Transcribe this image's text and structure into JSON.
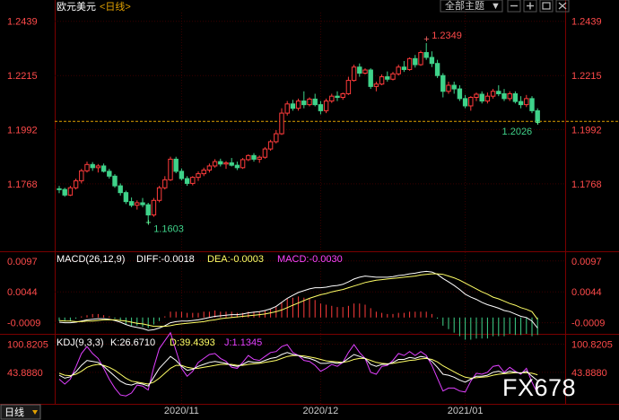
{
  "header": {
    "title": "欧元美元",
    "period": "<日线>",
    "mode_button": "全部主题",
    "mode_arrow": "▼"
  },
  "colors": {
    "up": "#ff3b3b",
    "down": "#3fd38a",
    "price_axis": "#ff4a4a",
    "last_price_line": "#e0a000",
    "diff": "#ffffff",
    "dea": "#ffff66",
    "macd_label": "#ff44ff",
    "k": "#ffffff",
    "d": "#ffff66",
    "j": "#e040ff",
    "grid": "#3a0000",
    "frame": "#7a0000"
  },
  "main": {
    "ylim": [
      1.149,
      1.2475
    ],
    "axis_ticks": [
      {
        "value": 1.2439,
        "label": "1.2439"
      },
      {
        "value": 1.2215,
        "label": "1.2215"
      },
      {
        "value": 1.1992,
        "label": "1.1992"
      },
      {
        "value": 1.1768,
        "label": "1.1768"
      }
    ],
    "high_label": "1.2349",
    "low_label": "1.1603",
    "last_label": "1.2026",
    "last_price": 1.2026
  },
  "chart_data": {
    "type": "candlestick",
    "series_name": "欧元美元",
    "period": "日线",
    "x_tick_labels": [
      {
        "index": 22,
        "label": "2020/11"
      },
      {
        "index": 47,
        "label": "2020/12"
      },
      {
        "index": 73,
        "label": "2021/01"
      }
    ],
    "ohlc": [
      [
        1.1748,
        1.176,
        1.173,
        1.1745
      ],
      [
        1.1745,
        1.1752,
        1.1715,
        1.1722
      ],
      [
        1.1722,
        1.176,
        1.1718,
        1.1752
      ],
      [
        1.1752,
        1.179,
        1.1745,
        1.1781
      ],
      [
        1.1781,
        1.183,
        1.177,
        1.1822
      ],
      [
        1.1822,
        1.186,
        1.1815,
        1.1848
      ],
      [
        1.1848,
        1.1858,
        1.1822,
        1.1835
      ],
      [
        1.1835,
        1.185,
        1.1815,
        1.1842
      ],
      [
        1.1842,
        1.1852,
        1.1815,
        1.182
      ],
      [
        1.182,
        1.183,
        1.179,
        1.18
      ],
      [
        1.18,
        1.1808,
        1.1752,
        1.176
      ],
      [
        1.176,
        1.177,
        1.172,
        1.1732
      ],
      [
        1.1732,
        1.174,
        1.1685,
        1.1695
      ],
      [
        1.1695,
        1.1712,
        1.1672,
        1.168
      ],
      [
        1.168,
        1.17,
        1.1662,
        1.169
      ],
      [
        1.169,
        1.171,
        1.1672,
        1.1682
      ],
      [
        1.1682,
        1.169,
        1.1603,
        1.164
      ],
      [
        1.164,
        1.171,
        1.1632,
        1.17
      ],
      [
        1.17,
        1.176,
        1.1692,
        1.1752
      ],
      [
        1.1752,
        1.18,
        1.1745,
        1.1785
      ],
      [
        1.1785,
        1.188,
        1.178,
        1.187
      ],
      [
        1.187,
        1.188,
        1.1812,
        1.182
      ],
      [
        1.182,
        1.1832,
        1.1782,
        1.179
      ],
      [
        1.179,
        1.18,
        1.176,
        1.177
      ],
      [
        1.177,
        1.18,
        1.1762,
        1.1795
      ],
      [
        1.1795,
        1.182,
        1.178,
        1.181
      ],
      [
        1.181,
        1.1835,
        1.18,
        1.1825
      ],
      [
        1.1825,
        1.1852,
        1.1815,
        1.1842
      ],
      [
        1.1842,
        1.187,
        1.1835,
        1.186
      ],
      [
        1.186,
        1.1872,
        1.184,
        1.185
      ],
      [
        1.185,
        1.1862,
        1.183,
        1.1855
      ],
      [
        1.1855,
        1.1875,
        1.184,
        1.1845
      ],
      [
        1.1845,
        1.186,
        1.1825,
        1.1835
      ],
      [
        1.1835,
        1.1875,
        1.183,
        1.1868
      ],
      [
        1.1868,
        1.189,
        1.1862,
        1.1885
      ],
      [
        1.1885,
        1.1895,
        1.186,
        1.187
      ],
      [
        1.187,
        1.1885,
        1.1855,
        1.1878
      ],
      [
        1.1878,
        1.192,
        1.1872,
        1.1912
      ],
      [
        1.1912,
        1.195,
        1.1905,
        1.1942
      ],
      [
        1.1942,
        1.199,
        1.1935,
        1.1975
      ],
      [
        1.1975,
        1.208,
        1.197,
        1.206
      ],
      [
        1.206,
        1.211,
        1.205,
        1.2098
      ],
      [
        1.2098,
        1.2115,
        1.207,
        1.208
      ],
      [
        1.208,
        1.212,
        1.207,
        1.211
      ],
      [
        1.211,
        1.215,
        1.208,
        1.2095
      ],
      [
        1.2095,
        1.2125,
        1.2088,
        1.2118
      ],
      [
        1.2118,
        1.214,
        1.2088,
        1.2095
      ],
      [
        1.2095,
        1.211,
        1.2055,
        1.207
      ],
      [
        1.207,
        1.212,
        1.206,
        1.211
      ],
      [
        1.211,
        1.214,
        1.2102,
        1.213
      ],
      [
        1.213,
        1.215,
        1.211,
        1.2125
      ],
      [
        1.2125,
        1.2145,
        1.2115,
        1.214
      ],
      [
        1.214,
        1.221,
        1.2135,
        1.2195
      ],
      [
        1.2195,
        1.226,
        1.219,
        1.225
      ],
      [
        1.225,
        1.2265,
        1.221,
        1.2225
      ],
      [
        1.2225,
        1.2245,
        1.222,
        1.2238
      ],
      [
        1.2238,
        1.2245,
        1.216,
        1.217
      ],
      [
        1.217,
        1.219,
        1.215,
        1.218
      ],
      [
        1.218,
        1.222,
        1.2175,
        1.221
      ],
      [
        1.221,
        1.2232,
        1.219,
        1.22
      ],
      [
        1.22,
        1.223,
        1.2195,
        1.2222
      ],
      [
        1.2222,
        1.226,
        1.2215,
        1.225
      ],
      [
        1.225,
        1.2275,
        1.223,
        1.224
      ],
      [
        1.224,
        1.229,
        1.2235,
        1.2285
      ],
      [
        1.2285,
        1.23,
        1.2248,
        1.226
      ],
      [
        1.226,
        1.2318,
        1.2255,
        1.231
      ],
      [
        1.231,
        1.2349,
        1.228,
        1.229
      ],
      [
        1.229,
        1.2315,
        1.225,
        1.2265
      ],
      [
        1.2265,
        1.228,
        1.2205,
        1.2215
      ],
      [
        1.2215,
        1.2225,
        1.2125,
        1.215
      ],
      [
        1.215,
        1.219,
        1.214,
        1.2175
      ],
      [
        1.2175,
        1.219,
        1.214,
        1.216
      ],
      [
        1.216,
        1.2175,
        1.211,
        1.212
      ],
      [
        1.212,
        1.2135,
        1.208,
        1.209
      ],
      [
        1.209,
        1.213,
        1.207,
        1.2125
      ],
      [
        1.2125,
        1.2145,
        1.211,
        1.2138
      ],
      [
        1.2138,
        1.215,
        1.21,
        1.211
      ],
      [
        1.211,
        1.2145,
        1.21,
        1.213
      ],
      [
        1.213,
        1.216,
        1.212,
        1.215
      ],
      [
        1.215,
        1.2175,
        1.213,
        1.214
      ],
      [
        1.214,
        1.216,
        1.211,
        1.212
      ],
      [
        1.212,
        1.215,
        1.211,
        1.214
      ],
      [
        1.214,
        1.215,
        1.21,
        1.2108
      ],
      [
        1.2108,
        1.213,
        1.208,
        1.2095
      ],
      [
        1.2095,
        1.2135,
        1.2085,
        1.212
      ],
      [
        1.212,
        1.213,
        1.206,
        1.207
      ],
      [
        1.207,
        1.208,
        1.2015,
        1.2026
      ]
    ],
    "macd": {
      "params": "MACD(26,12,9)",
      "diff_label": "DIFF:-0.0018",
      "dea_label": "DEA:-0.0003",
      "macd_label": "MACD:-0.0030",
      "ylim": [
        -0.0028,
        0.0112
      ],
      "axis_ticks": [
        {
          "value": 0.0097,
          "label": "0.0097"
        },
        {
          "value": 0.0044,
          "label": "0.0044"
        },
        {
          "value": -0.0009,
          "label": "-0.0009"
        }
      ],
      "diff": [
        -0.0008,
        -0.0009,
        -0.0009,
        -0.0008,
        -0.0006,
        -0.0004,
        -0.0003,
        -0.0002,
        -0.0002,
        -0.0003,
        -0.0005,
        -0.0008,
        -0.0012,
        -0.0015,
        -0.0017,
        -0.0019,
        -0.0022,
        -0.0021,
        -0.0018,
        -0.0014,
        -0.0009,
        -0.0007,
        -0.0006,
        -0.0006,
        -0.0005,
        -0.0004,
        -0.0002,
        0.0,
        0.0002,
        0.0003,
        0.0004,
        0.0005,
        0.0005,
        0.0006,
        0.0008,
        0.0009,
        0.001,
        0.0012,
        0.0015,
        0.0019,
        0.0026,
        0.0033,
        0.0038,
        0.0043,
        0.0046,
        0.0049,
        0.0051,
        0.0051,
        0.0052,
        0.0054,
        0.0055,
        0.0057,
        0.0061,
        0.0066,
        0.0069,
        0.0071,
        0.007,
        0.0069,
        0.0069,
        0.0069,
        0.007,
        0.0072,
        0.0073,
        0.0075,
        0.0076,
        0.0078,
        0.0079,
        0.0078,
        0.0074,
        0.0067,
        0.0061,
        0.0055,
        0.0048,
        0.004,
        0.0035,
        0.0031,
        0.0026,
        0.0022,
        0.0019,
        0.0016,
        0.0012,
        0.001,
        0.0006,
        0.0002,
        0.0,
        -0.0006,
        -0.0018
      ],
      "dea": [
        -0.0005,
        -0.0006,
        -0.0006,
        -0.0007,
        -0.0007,
        -0.0006,
        -0.0006,
        -0.0005,
        -0.0004,
        -0.0004,
        -0.0004,
        -0.0005,
        -0.0006,
        -0.0008,
        -0.001,
        -0.0011,
        -0.0013,
        -0.0015,
        -0.0015,
        -0.0015,
        -0.0014,
        -0.0012,
        -0.0011,
        -0.001,
        -0.0009,
        -0.0008,
        -0.0007,
        -0.0005,
        -0.0004,
        -0.0002,
        -0.0001,
        0.0,
        0.0001,
        0.0002,
        0.0003,
        0.0004,
        0.0005,
        0.0006,
        0.0008,
        0.001,
        0.0013,
        0.0017,
        0.0021,
        0.0025,
        0.0029,
        0.0033,
        0.0036,
        0.0039,
        0.0041,
        0.0044,
        0.0046,
        0.0048,
        0.0051,
        0.0054,
        0.0057,
        0.006,
        0.0062,
        0.0064,
        0.0065,
        0.0066,
        0.0067,
        0.0068,
        0.0069,
        0.007,
        0.0071,
        0.0073,
        0.0074,
        0.0075,
        0.0075,
        0.0074,
        0.0071,
        0.0068,
        0.0064,
        0.0059,
        0.0054,
        0.0049,
        0.0044,
        0.004,
        0.0035,
        0.0032,
        0.0028,
        0.0024,
        0.0021,
        0.0017,
        0.0014,
        0.001,
        -0.0003
      ],
      "histogram": [
        -0.0006,
        -0.0006,
        -0.0006,
        -0.0002,
        0.0002,
        0.0004,
        0.0006,
        0.0006,
        0.0004,
        0.0002,
        -0.0002,
        -0.0006,
        -0.0012,
        -0.0014,
        -0.0014,
        -0.0016,
        -0.0018,
        -0.0012,
        -0.0006,
        0.0002,
        0.001,
        0.001,
        0.001,
        0.0008,
        0.0008,
        0.0008,
        0.001,
        0.001,
        0.0012,
        0.001,
        0.001,
        0.001,
        0.0008,
        0.0008,
        0.001,
        0.001,
        0.001,
        0.0012,
        0.0014,
        0.0018,
        0.0026,
        0.0032,
        0.0034,
        0.0036,
        0.0034,
        0.0032,
        0.003,
        0.0024,
        0.0022,
        0.002,
        0.0018,
        0.0018,
        0.002,
        0.0024,
        0.0024,
        0.0022,
        0.0016,
        0.001,
        0.0008,
        0.0006,
        0.0006,
        0.0008,
        0.0008,
        0.001,
        0.001,
        0.001,
        0.001,
        0.0006,
        -0.0002,
        -0.0014,
        -0.002,
        -0.0026,
        -0.0032,
        -0.0038,
        -0.0038,
        -0.0036,
        -0.0036,
        -0.0036,
        -0.0032,
        -0.0032,
        -0.0032,
        -0.0028,
        -0.003,
        -0.003,
        -0.0028,
        -0.0032,
        -0.003
      ]
    },
    "kdj": {
      "params": "KDJ(9,3,3)",
      "k_label": "K:26.6710",
      "d_label": "D:39.4393",
      "j_label": "J:1.1345",
      "ylim": [
        -20,
        120
      ],
      "axis_ticks": [
        {
          "value": 100.8205,
          "label": "100.8205"
        },
        {
          "value": 43.888,
          "label": "43.8880"
        }
      ],
      "k": [
        38,
        32,
        35,
        45,
        58,
        68,
        66,
        64,
        56,
        46,
        36,
        26,
        20,
        18,
        22,
        20,
        16,
        34,
        52,
        64,
        76,
        68,
        56,
        48,
        50,
        56,
        60,
        64,
        66,
        64,
        62,
        58,
        56,
        60,
        66,
        64,
        64,
        68,
        72,
        74,
        80,
        84,
        80,
        78,
        74,
        72,
        68,
        62,
        62,
        64,
        62,
        64,
        72,
        80,
        76,
        72,
        60,
        56,
        60,
        60,
        64,
        70,
        70,
        74,
        72,
        76,
        74,
        66,
        54,
        40,
        38,
        34,
        28,
        24,
        30,
        36,
        36,
        38,
        44,
        46,
        42,
        46,
        44,
        42,
        46,
        36,
        27
      ],
      "d": [
        42,
        38,
        37,
        40,
        46,
        54,
        58,
        60,
        58,
        54,
        48,
        40,
        32,
        26,
        24,
        22,
        20,
        24,
        32,
        42,
        52,
        58,
        58,
        54,
        52,
        52,
        54,
        56,
        58,
        60,
        60,
        60,
        58,
        58,
        60,
        61,
        62,
        64,
        66,
        68,
        72,
        76,
        78,
        78,
        77,
        75,
        73,
        70,
        67,
        66,
        65,
        64,
        66,
        70,
        72,
        72,
        68,
        64,
        62,
        61,
        62,
        64,
        66,
        68,
        69,
        71,
        72,
        70,
        65,
        57,
        51,
        45,
        39,
        34,
        32,
        33,
        34,
        35,
        38,
        40,
        41,
        42,
        43,
        43,
        43,
        42,
        39
      ],
      "j": [
        30,
        20,
        30,
        55,
        82,
        96,
        82,
        72,
        52,
        30,
        12,
        -2,
        -4,
        2,
        18,
        16,
        8,
        54,
        92,
        108,
        124,
        88,
        52,
        36,
        46,
        64,
        72,
        80,
        82,
        72,
        66,
        54,
        52,
        64,
        78,
        70,
        68,
        76,
        84,
        86,
        96,
        100,
        84,
        78,
        68,
        66,
        58,
        46,
        52,
        60,
        56,
        64,
        84,
        100,
        84,
        72,
        44,
        40,
        56,
        58,
        68,
        82,
        78,
        86,
        78,
        86,
        78,
        58,
        32,
        6,
        12,
        12,
        6,
        4,
        26,
        42,
        40,
        44,
        56,
        58,
        44,
        54,
        46,
        40,
        52,
        24,
        1
      ]
    }
  },
  "kdj_box_label": "日线",
  "watermark": "FX678"
}
